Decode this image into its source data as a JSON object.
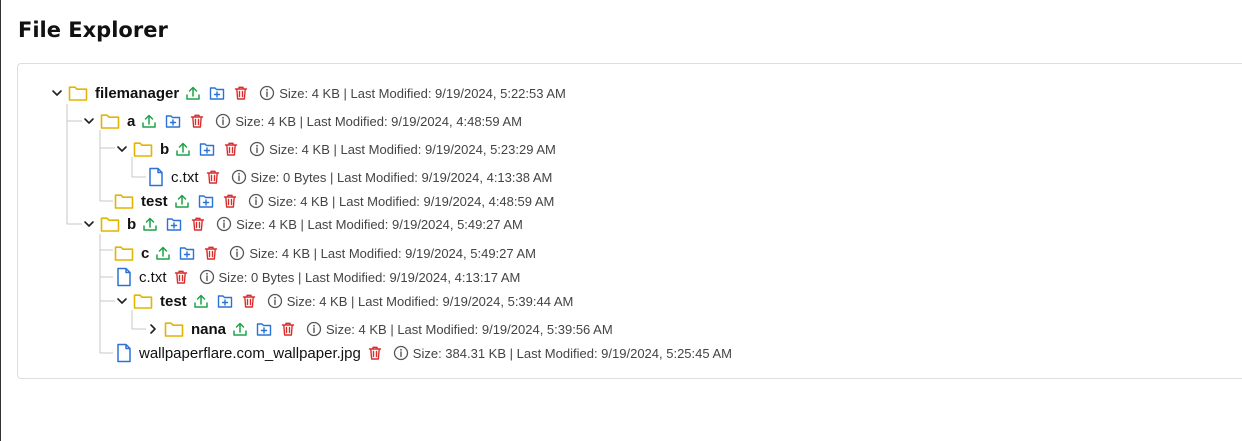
{
  "page": {
    "title": "File Explorer"
  },
  "colors": {
    "folder": "#e2b500",
    "file": "#2b72d6",
    "upload": "#1ea34a",
    "new_folder": "#2b72d6",
    "delete": "#d92d2d",
    "info": "#555555"
  },
  "rows": [
    {
      "name": "filemanager",
      "type": "folder",
      "expanded": true,
      "meta": "Size: 4 KB | Last Modified: 9/19/2024, 5:22:53 AM"
    },
    {
      "name": "a",
      "type": "folder",
      "expanded": true,
      "meta": "Size: 4 KB | Last Modified: 9/19/2024, 4:48:59 AM"
    },
    {
      "name": "b",
      "type": "folder",
      "expanded": true,
      "meta": "Size: 4 KB | Last Modified: 9/19/2024, 5:23:29 AM"
    },
    {
      "name": "c.txt",
      "type": "file",
      "meta": "Size: 0 Bytes | Last Modified: 9/19/2024, 4:13:38 AM"
    },
    {
      "name": "test",
      "type": "folder",
      "meta": "Size: 4 KB | Last Modified: 9/19/2024, 4:48:59 AM"
    },
    {
      "name": "b",
      "type": "folder",
      "expanded": true,
      "meta": "Size: 4 KB | Last Modified: 9/19/2024, 5:49:27 AM"
    },
    {
      "name": "c",
      "type": "folder",
      "meta": "Size: 4 KB | Last Modified: 9/19/2024, 5:49:27 AM"
    },
    {
      "name": "c.txt",
      "type": "file",
      "meta": "Size: 0 Bytes | Last Modified: 9/19/2024, 4:13:17 AM"
    },
    {
      "name": "test",
      "type": "folder",
      "expanded": true,
      "meta": "Size: 4 KB | Last Modified: 9/19/2024, 5:39:44 AM"
    },
    {
      "name": "nana",
      "type": "folder",
      "expanded": false,
      "meta": "Size: 4 KB | Last Modified: 9/19/2024, 5:39:56 AM"
    },
    {
      "name": "wallpaperflare.com_wallpaper.jpg",
      "type": "file",
      "meta": "Size: 384.31 KB | Last Modified: 9/19/2024, 5:25:45 AM"
    }
  ]
}
